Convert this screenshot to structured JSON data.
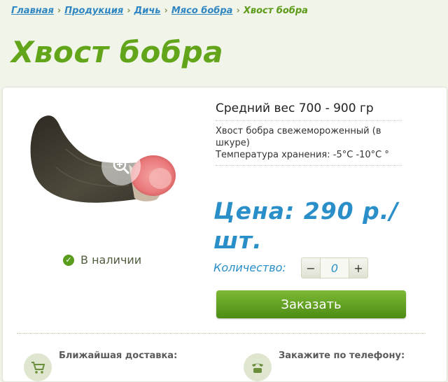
{
  "breadcrumb": {
    "items": [
      "Главная",
      "Продукция",
      "Дичь",
      "Мясо бобра"
    ],
    "separator": "›",
    "current": "Хвост бобра"
  },
  "page_title": "Хвост бобра",
  "product": {
    "stock_status": "В наличии",
    "average_weight": "Средний вес 700 - 900 гр",
    "description_line1": "Хвост бобра свежемороженный (в шкуре)",
    "description_line2": "Температура хранения: -5°С -10°С °",
    "price": "Цена: 290 р./ шт.",
    "quantity_label": "Количество:",
    "quantity_value": "0",
    "decrement": "−",
    "increment": "+",
    "order_label": "Заказать"
  },
  "footer_info": {
    "delivery_label": "Ближайшая доставка:",
    "phone_label": "Закажите по телефону:"
  },
  "colors": {
    "accent_green": "#62a51a",
    "price_blue": "#2a8fc9",
    "link_blue": "#2f86c2",
    "button_green": "#5a9d1c"
  },
  "icons": [
    "zoom-icon",
    "check-icon",
    "cart-icon",
    "phone-icon"
  ]
}
